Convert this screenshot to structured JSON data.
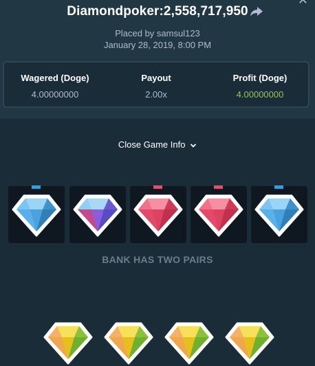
{
  "header": {
    "title": "Diamondpoker:2,558,717,950",
    "placed_by": "Placed by samsul123",
    "date": "January 28, 2019, 8:00 PM"
  },
  "stats": {
    "wagered_label": "Wagered (Doge)",
    "wagered_value": "4.00000000",
    "payout_label": "Payout",
    "payout_value": "2.00x",
    "profit_label": "Profit (Doge)",
    "profit_value": "4.00000000"
  },
  "toggle": {
    "label": "Close Game Info"
  },
  "dealer_hand": [
    {
      "gem": "blue-diamond",
      "pip_color": "#3b9cdc"
    },
    {
      "gem": "purple-blue-diamond",
      "pip_color": ""
    },
    {
      "gem": "red-diamond",
      "pip_color": "#e0506a"
    },
    {
      "gem": "red-diamond",
      "pip_color": "#e0506a"
    },
    {
      "gem": "blue-diamond",
      "pip_color": "#3b9cdc"
    }
  ],
  "result_text": "BANK HAS TWO PAIRS",
  "player_hand": [
    {
      "gem": "yellow-green-diamond"
    },
    {
      "gem": "yellow-green-diamond"
    },
    {
      "gem": "yellow-green-diamond"
    },
    {
      "gem": "yellow-green-diamond"
    }
  ],
  "colors": {
    "background": "#1a2c38",
    "header_bg": "#213743",
    "profit_green": "#93c35e",
    "muted_text": "#b1bad3"
  }
}
